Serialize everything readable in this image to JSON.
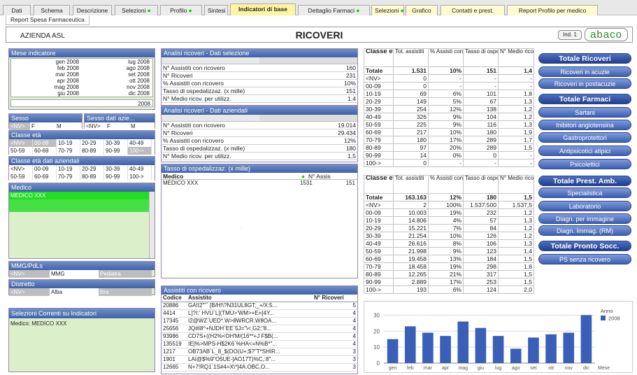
{
  "tabs": [
    {
      "label": "Dati",
      "dot": false,
      "style": "normal"
    },
    {
      "label": "Schema",
      "dot": false,
      "style": "normal"
    },
    {
      "label": "Descrizione",
      "dot": false,
      "style": "normal"
    },
    {
      "label": "Selezioni",
      "dot": true,
      "style": "normal"
    },
    {
      "label": "Profilo",
      "dot": true,
      "style": "normal"
    },
    {
      "label": "Sintesi",
      "dot": true,
      "style": "normal"
    },
    {
      "label": "Indicatori di base",
      "dot": false,
      "style": "active"
    },
    {
      "label": "Dettaglio Farmaci",
      "dot": true,
      "style": "normal"
    },
    {
      "label": "Selezioni",
      "dot": true,
      "style": "yellow"
    },
    {
      "label": "Grafico",
      "dot": false,
      "style": "yellow"
    },
    {
      "label": "Contatti e prest.",
      "dot": false,
      "style": "yellow"
    },
    {
      "label": "Report Profilo per medico",
      "dot": false,
      "style": "yellow"
    }
  ],
  "subtab": "Report Spesa Farmaceutica",
  "header": {
    "azienda": "AZIENDA ASL",
    "title": "RICOVERI",
    "ind_button": "Ind. 1",
    "logo": "abaco"
  },
  "mese": {
    "title": "Mese indicatore",
    "rows": [
      [
        "gen 2008",
        "lug 2008"
      ],
      [
        "feb 2008",
        "ago 2008"
      ],
      [
        "mar 2008",
        "set 2008"
      ],
      [
        "apr 2008",
        "ott 2008"
      ],
      [
        "mag 2008",
        "nov 2008"
      ],
      [
        "giu 2008",
        "dic 2008"
      ]
    ],
    "year": "2008"
  },
  "sesso": {
    "title": "Sesso",
    "opts": [
      "<NV>",
      "F",
      "M"
    ]
  },
  "sesso_az": {
    "title": "Sesso dati azie...",
    "opts": [
      "<NV>",
      "F",
      "M"
    ]
  },
  "classe_eta": {
    "title": "Classe età",
    "row1": [
      "<NV>",
      "00-09",
      "10-19",
      "20-29",
      "30-39",
      "40-49"
    ],
    "row2": [
      "50-59",
      "60-69",
      "70-79",
      "80-89",
      "90-99",
      "100->"
    ]
  },
  "classe_eta_az": {
    "title": "Classe età dati aziendali",
    "row1": [
      "<NV>",
      "00-09",
      "10-19",
      "20-29",
      "30-39",
      "40-49"
    ],
    "row2": [
      "50-59",
      "60-69",
      "70-79",
      "80-89",
      "90-99",
      "100->"
    ]
  },
  "medico": {
    "title": "Medico",
    "selected": "MEDICO XXX"
  },
  "mmg": {
    "title": "MMG/PdLs",
    "opts": [
      "<NV>",
      "MMG",
      "Pediatra"
    ]
  },
  "distretto": {
    "title": "Distretto",
    "opts": [
      "<NV>",
      "Alba",
      "Bra"
    ]
  },
  "selezioni": {
    "title": "Selezioni Correnti su Indicatori",
    "label": "Medico:",
    "value": "MEDICO XXX"
  },
  "analisi_sel": {
    "title": "Analisi ricoveri - Dati selezione",
    "rows": [
      [
        "N° Assistiti con ricovero",
        "160"
      ],
      [
        "N° Ricoveri",
        "231"
      ],
      [
        "% Assistiti con ricovero",
        "10%"
      ],
      [
        "Tasso di ospedalizzaz. (x mille)",
        "151"
      ],
      [
        "N° Medio ricov. per utilizz.",
        "1,4"
      ]
    ]
  },
  "analisi_az": {
    "title": "Analisi ricoveri - Dati aziendali",
    "rows": [
      [
        "N° Assistiti con ricovero",
        "19.014"
      ],
      [
        "N° Ricoveri",
        "29.434"
      ],
      [
        "% Assistiti con ricovero",
        "12%"
      ],
      [
        "Tasso di ospedalizzaz. (x mille)",
        "180"
      ],
      [
        "N° Medio ricov. per utilizz.",
        "1,5"
      ]
    ]
  },
  "tasso": {
    "title": "Tasso di ospedalizzaz. (x mille)",
    "col1": "Medico",
    "col2": "N° Assis",
    "row": [
      "MEDICO XXX",
      "1531",
      "151"
    ]
  },
  "assistiti": {
    "title": "Assistiti con ricovero",
    "headers": [
      "Codice",
      "Assistito",
      "N° Ricoveri"
    ],
    "rows": [
      [
        "20886",
        "GA!I2\"\"` [B/H!\\?N31UL8GT;_+/X:5...",
        "5"
      ],
      [
        "4414",
        "L]?I:' HVU`L[(TMU>'WM>+E=[4Y...",
        "4"
      ],
      [
        "17345",
        "I2@WZ`UED*.W>8WRCR.W8OA...",
        "4"
      ],
      [
        "25656",
        "JQ#I8^+NJDH`EE`5J=\"\\<,G2;\"8...",
        "4"
      ],
      [
        "93986",
        "CD7S+((H2%<OH'M/(16**+J F$B(...",
        "4"
      ],
      [
        "135519",
        "IE]%>MPS-H$2K6`%HA<=N%B*\"...",
        "4"
      ],
      [
        "1217",
        "OB73AB`L_8_$(DO(U+;$?\"T*SHIR...",
        "3"
      ],
      [
        "1901",
        "LAI@$%9\"O5UE-]AO17T)%C,:8\"...",
        "3"
      ],
      [
        "12665",
        "N+7!RQ1`1S#4=X\\*]4A.OBC,O...",
        "3"
      ]
    ]
  },
  "stat1": {
    "headers": [
      "Classe età",
      "Tot. assistiti",
      "% Assisti con ricovero",
      "Tasso di ospedalizz az. (x...",
      "N° Medio ricov. per utilizz."
    ],
    "total": [
      "Totale",
      "1.531",
      "10%",
      "151",
      "1,4"
    ],
    "rows": [
      [
        "<NV>",
        "0",
        "-",
        "-",
        "-"
      ],
      [
        "00-09",
        "0",
        "-",
        "-",
        "-"
      ],
      [
        "10-19",
        "69",
        "6%",
        "101",
        "1,8"
      ],
      [
        "20-29",
        "149",
        "5%",
        "67",
        "1,3"
      ],
      [
        "30-39",
        "254",
        "12%",
        "138",
        "1,2"
      ],
      [
        "40-49",
        "326",
        "9%",
        "104",
        "1,2"
      ],
      [
        "50-59",
        "225",
        "9%",
        "116",
        "1,3"
      ],
      [
        "60-69",
        "217",
        "10%",
        "180",
        "1,9"
      ],
      [
        "70-79",
        "180",
        "17%",
        "289",
        "1,7"
      ],
      [
        "80-89",
        "97",
        "20%",
        "289",
        "1,5"
      ],
      [
        "90-99",
        "14",
        "0%",
        "0",
        "-"
      ],
      [
        "100->",
        "0",
        "-",
        "-",
        "-"
      ]
    ]
  },
  "stat2": {
    "headers": [
      "Classe età",
      "Tot. assistiti",
      "% Assisti con ricovero",
      "Tasso di ospedaliz az. (x...",
      "N° Medio ricov. per utilizz."
    ],
    "total": [
      "Totale",
      "163.163",
      "12%",
      "180",
      "1,5"
    ],
    "rows": [
      [
        "<NV>",
        "2",
        "100%",
        "1.537.500",
        "1.537,5"
      ],
      [
        "00-09",
        "10.003",
        "19%",
        "232",
        "1,2"
      ],
      [
        "10-19",
        "14.806",
        "4%",
        "57",
        "1,3"
      ],
      [
        "20-29",
        "15.221",
        "7%",
        "84",
        "1,2"
      ],
      [
        "30-39",
        "21.254",
        "10%",
        "126",
        "1,2"
      ],
      [
        "40-49",
        "26.616",
        "8%",
        "106",
        "1,3"
      ],
      [
        "50-59",
        "21.998",
        "9%",
        "123",
        "1,4"
      ],
      [
        "60-69",
        "19.458",
        "13%",
        "184",
        "1,5"
      ],
      [
        "70-79",
        "18.458",
        "19%",
        "298",
        "1,6"
      ],
      [
        "80-89",
        "12.265",
        "21%",
        "317",
        "1,5"
      ],
      [
        "90-99",
        "2.889",
        "17%",
        "253",
        "1,5"
      ],
      [
        "100->",
        "193",
        "6%",
        "124",
        "2,0"
      ]
    ]
  },
  "buttons": [
    {
      "label": "Totale Ricoveri",
      "head": true
    },
    {
      "label": "Ricoveri in acuzie",
      "head": false
    },
    {
      "label": "Ricoveri in postacuzie",
      "head": false
    },
    {
      "label": "Totale Farmaci",
      "head": true
    },
    {
      "label": "Sartani",
      "head": false
    },
    {
      "label": "Inibitori angiotensina",
      "head": false
    },
    {
      "label": "Gastroprotettori",
      "head": false
    },
    {
      "label": "Antipsicotici atipici",
      "head": false
    },
    {
      "label": "Psicolettici",
      "head": false
    },
    {
      "label": "Totale Prest. Amb.",
      "head": true
    },
    {
      "label": "Specialistica",
      "head": false
    },
    {
      "label": "Laboratorio",
      "head": false
    },
    {
      "label": "Diagn. per immagine",
      "head": false
    },
    {
      "label": "Diagn. Immag. (RM)",
      "head": false
    },
    {
      "label": "Totale Pronto Socc.",
      "head": true
    },
    {
      "label": "PS senza ricovero",
      "head": false
    }
  ],
  "chart_data": {
    "type": "bar",
    "categories": [
      "gen",
      "feb",
      "mar",
      "apr",
      "mag",
      "giu",
      "lug",
      "ago",
      "set",
      "ott",
      "nov",
      "dic"
    ],
    "series": [
      {
        "name": "2008",
        "values": [
          15,
          23,
          19,
          17,
          26,
          22,
          17,
          9,
          16,
          18,
          19,
          30
        ]
      }
    ],
    "xlabel": "Mese",
    "ylabel": "",
    "ylim": [
      0,
      35
    ],
    "yticks": [
      0,
      10,
      20,
      30
    ],
    "legend_title": "Anno",
    "legend": "top-right",
    "bar_color": "#3a5fb8",
    "grid": true
  }
}
